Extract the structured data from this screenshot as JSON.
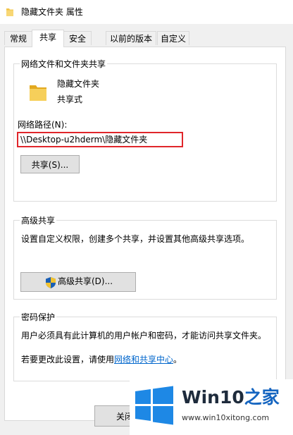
{
  "window": {
    "title": "隐藏文件夹 属性"
  },
  "tabs": [
    {
      "label": "常规"
    },
    {
      "label": "共享"
    },
    {
      "label": "安全"
    },
    {
      "label": "以前的版本"
    },
    {
      "label": "自定义"
    }
  ],
  "active_tab": "共享",
  "network_share": {
    "group_title": "网络文件和文件夹共享",
    "folder_name": "隐藏文件夹",
    "share_status": "共享式",
    "path_label": "网络路径(N):",
    "path_value": "\\\\Desktop-u2hderm\\隐藏文件夹",
    "share_button": "共享(S)..."
  },
  "advanced_share": {
    "group_title": "高级共享",
    "description": "设置自定义权限，创建多个共享，并设置其他高级共享选项。",
    "button": "高级共享(D)..."
  },
  "password_protect": {
    "group_title": "密码保护",
    "description": "用户必须具有此计算机的用户帐户和密码，才能访问共享文件夹。",
    "change_prefix": "若要更改此设置，请使用",
    "link_text": "网络和共享中心",
    "change_suffix": "。"
  },
  "footer": {
    "close_button": "关闭"
  },
  "watermark": {
    "brand_main": "Win10",
    "brand_accent": "之家",
    "url": "www.win10xitong.com"
  },
  "colors": {
    "path_highlight": "#e0262b",
    "link": "#0066cc",
    "folder": "#f2c447",
    "win_logo": "#1e88e5"
  }
}
